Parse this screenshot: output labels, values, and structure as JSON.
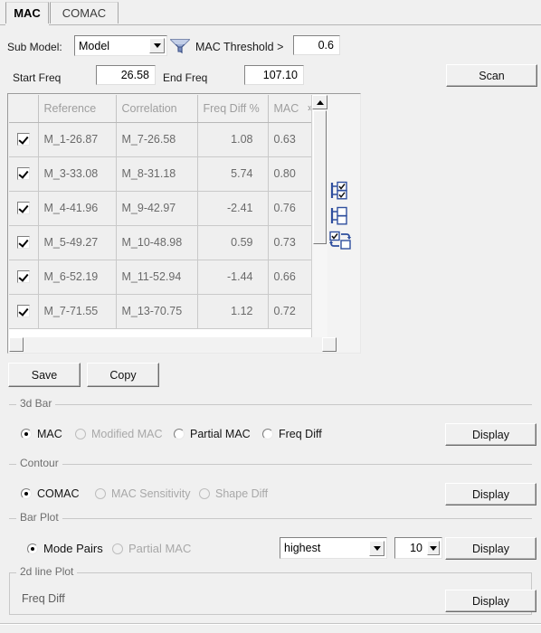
{
  "window": {
    "title": "MAC / COMAC Correlation Panel"
  },
  "tabs": [
    {
      "label": "MAC",
      "selected": true
    },
    {
      "label": "COMAC",
      "selected": false
    }
  ],
  "toolbar": {
    "sub_model_label": "Sub Model:",
    "sub_model_value": "Model",
    "filter_icon": "funnel-filter-icon",
    "mac_threshold_label": "MAC Threshold >",
    "mac_threshold_value": "0.6",
    "start_freq_label": "Start Freq",
    "start_freq_value": "26.58",
    "end_freq_label": "End Freq",
    "end_freq_value": "107.10",
    "scan_label": "Scan"
  },
  "table": {
    "columns": [
      "",
      "Reference",
      "Correlation",
      "Freq Diff %",
      "MAC"
    ],
    "overflow_indicator": "»",
    "rows": [
      {
        "checked": true,
        "reference": "M_1-26.87",
        "correlation": "M_7-26.58",
        "freq_diff": "1.08",
        "mac": "0.63"
      },
      {
        "checked": true,
        "reference": "M_3-33.08",
        "correlation": "M_8-31.18",
        "freq_diff": "5.74",
        "mac": "0.80"
      },
      {
        "checked": true,
        "reference": "M_4-41.96",
        "correlation": "M_9-42.97",
        "freq_diff": "-2.41",
        "mac": "0.76"
      },
      {
        "checked": true,
        "reference": "M_5-49.27",
        "correlation": "M_10-48.98",
        "freq_diff": "0.59",
        "mac": "0.73"
      },
      {
        "checked": true,
        "reference": "M_6-52.19",
        "correlation": "M_11-52.94",
        "freq_diff": "-1.44",
        "mac": "0.66"
      },
      {
        "checked": true,
        "reference": "M_7-71.55",
        "correlation": "M_13-70.75",
        "freq_diff": "1.12",
        "mac": "0.72"
      }
    ]
  },
  "selection_tools": [
    {
      "name": "check-all-icon"
    },
    {
      "name": "uncheck-all-icon"
    },
    {
      "name": "invert-selection-icon"
    }
  ],
  "actions": {
    "save_label": "Save",
    "copy_label": "Copy"
  },
  "sections": {
    "bar3d": {
      "title": "3d Bar",
      "options": [
        {
          "label": "MAC",
          "selected": true,
          "disabled": false
        },
        {
          "label": "Modified MAC",
          "selected": false,
          "disabled": true
        },
        {
          "label": "Partial MAC",
          "selected": false,
          "disabled": false
        },
        {
          "label": "Freq Diff",
          "selected": false,
          "disabled": false
        }
      ],
      "display_label": "Display"
    },
    "contour": {
      "title": "Contour",
      "options": [
        {
          "label": "COMAC",
          "selected": true,
          "disabled": false
        },
        {
          "label": "MAC Sensitivity",
          "selected": false,
          "disabled": true
        },
        {
          "label": "Shape Diff",
          "selected": false,
          "disabled": true
        }
      ],
      "display_label": "Display"
    },
    "barplot": {
      "title": "Bar Plot",
      "options": [
        {
          "label": "Mode Pairs",
          "selected": true,
          "disabled": false
        },
        {
          "label": "Partial MAC",
          "selected": false,
          "disabled": true
        }
      ],
      "sort_value": "highest",
      "count_value": "10",
      "display_label": "Display"
    },
    "line2d": {
      "title": "2d line Plot",
      "label": "Freq Diff",
      "display_label": "Display"
    }
  },
  "colors": {
    "panel": "#f0f0f0",
    "field": "#ffffff",
    "grid_row": "#efefef",
    "header_text": "#9e9e9e",
    "cell_text": "#6a6a6a",
    "disabled_text": "#a8a8a8",
    "icon_blue": "#2f4f9e"
  }
}
